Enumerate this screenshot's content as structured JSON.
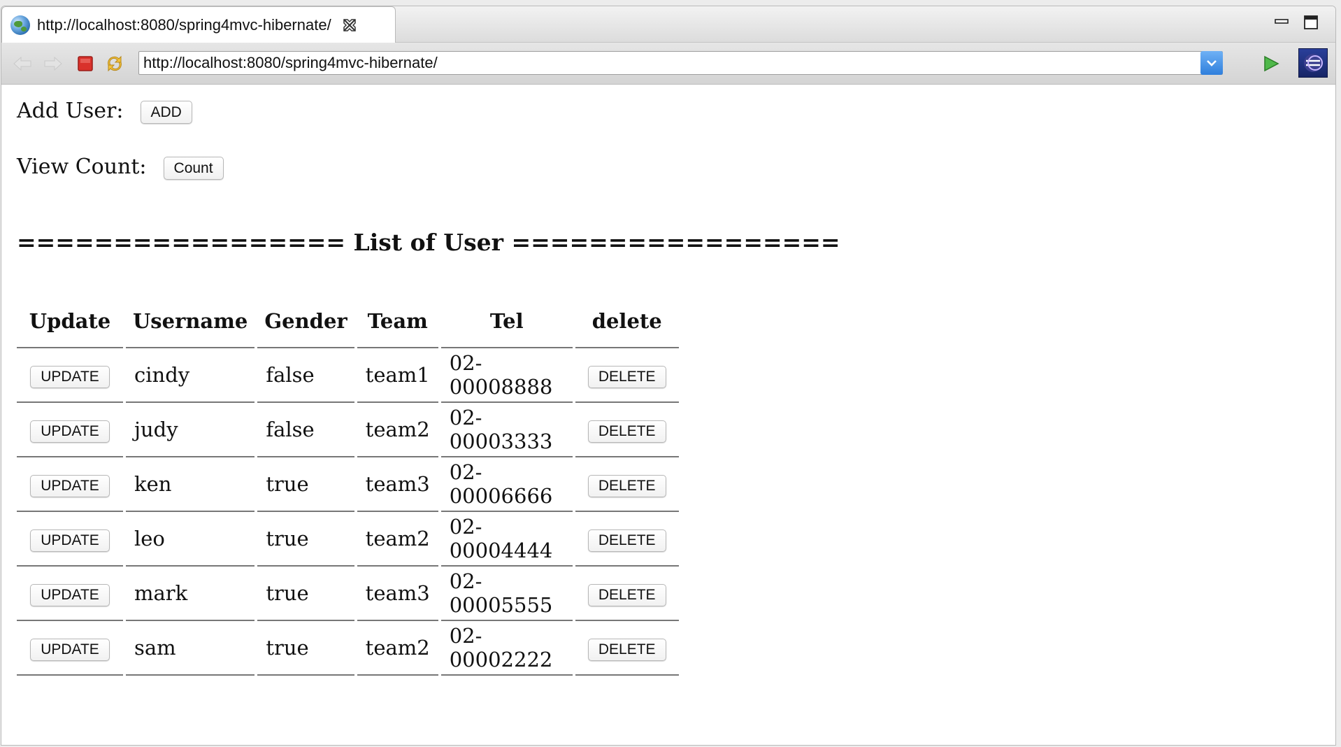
{
  "browser": {
    "tab_title": "http://localhost:8080/spring4mvc-hibernate/",
    "url": "http://localhost:8080/spring4mvc-hibernate/"
  },
  "page": {
    "add_user_label": "Add User:",
    "add_button": "ADD",
    "view_count_label": "View Count:",
    "count_button": "Count",
    "list_heading": "================= List of User ================="
  },
  "table": {
    "headers": [
      "Update",
      "Username",
      "Gender",
      "Team",
      "Tel",
      "delete"
    ],
    "rows": [
      {
        "update": "UPDATE",
        "username": "cindy",
        "gender": "false",
        "team": "team1",
        "tel": "02-00008888",
        "delete": "DELETE"
      },
      {
        "update": "UPDATE",
        "username": "judy",
        "gender": "false",
        "team": "team2",
        "tel": "02-00003333",
        "delete": "DELETE"
      },
      {
        "update": "UPDATE",
        "username": "ken",
        "gender": "true",
        "team": "team3",
        "tel": "02-00006666",
        "delete": "DELETE"
      },
      {
        "update": "UPDATE",
        "username": "leo",
        "gender": "true",
        "team": "team2",
        "tel": "02-00004444",
        "delete": "DELETE"
      },
      {
        "update": "UPDATE",
        "username": "mark",
        "gender": "true",
        "team": "team3",
        "tel": "02-00005555",
        "delete": "DELETE"
      },
      {
        "update": "UPDATE",
        "username": "sam",
        "gender": "true",
        "team": "team2",
        "tel": "02-00002222",
        "delete": "DELETE"
      }
    ]
  },
  "icons": {
    "tab": "globe-icon",
    "tab_close": "close-icon",
    "back": "back-arrow-icon",
    "forward": "forward-arrow-icon",
    "stop": "stop-icon",
    "refresh": "refresh-icon",
    "dropdown": "chevron-down-icon",
    "go": "play-icon",
    "eclipse": "eclipse-icon"
  }
}
